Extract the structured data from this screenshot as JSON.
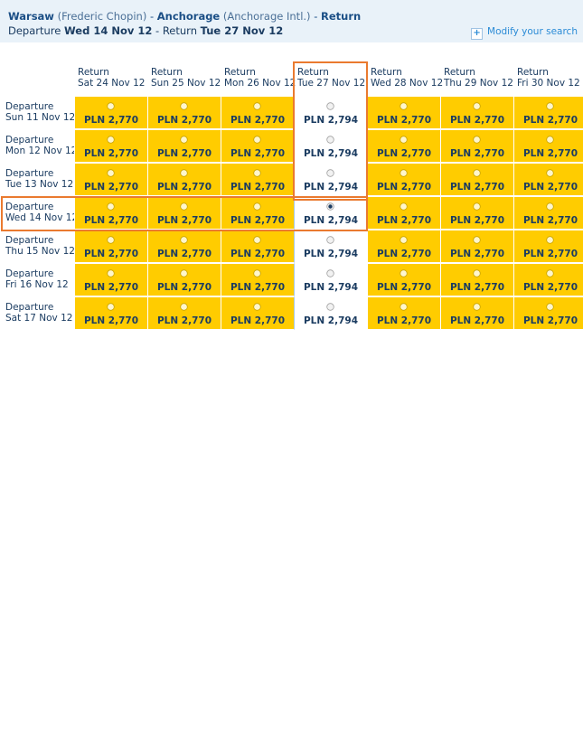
{
  "header": {
    "origin_city": "Warsaw",
    "origin_airport": "(Frederic Chopin)",
    "separator": "-",
    "destination_city": "Anchorage",
    "destination_airport": "(Anchorage Intl.)",
    "trip_type": "Return",
    "departure_label": "Departure",
    "departure_date": "Wed 14 Nov 12",
    "return_label": "- Return",
    "return_date": "Tue 27 Nov 12",
    "modify_link": "Modify your search"
  },
  "columns": [
    {
      "label": "Return",
      "date": "Sat 24 Nov 12"
    },
    {
      "label": "Return",
      "date": "Sun 25 Nov 12"
    },
    {
      "label": "Return",
      "date": "Mon 26 Nov 12"
    },
    {
      "label": "Return",
      "date": "Tue 27 Nov 12"
    },
    {
      "label": "Return",
      "date": "Wed 28 Nov 12"
    },
    {
      "label": "Return",
      "date": "Thu 29 Nov 12"
    },
    {
      "label": "Return",
      "date": "Fri 30 Nov 12"
    }
  ],
  "rows": [
    {
      "label": "Departure",
      "date": "Sun 11 Nov 12",
      "prices": [
        "PLN 2,770",
        "PLN 2,770",
        "PLN 2,770",
        "PLN 2,794",
        "PLN 2,770",
        "PLN 2,770",
        "PLN 2,770"
      ]
    },
    {
      "label": "Departure",
      "date": "Mon 12 Nov 12",
      "prices": [
        "PLN 2,770",
        "PLN 2,770",
        "PLN 2,770",
        "PLN 2,794",
        "PLN 2,770",
        "PLN 2,770",
        "PLN 2,770"
      ]
    },
    {
      "label": "Departure",
      "date": "Tue 13 Nov 12",
      "prices": [
        "PLN 2,770",
        "PLN 2,770",
        "PLN 2,770",
        "PLN 2,794",
        "PLN 2,770",
        "PLN 2,770",
        "PLN 2,770"
      ]
    },
    {
      "label": "Departure",
      "date": "Wed 14 Nov 12",
      "prices": [
        "PLN 2,770",
        "PLN 2,770",
        "PLN 2,770",
        "PLN 2,794",
        "PLN 2,770",
        "PLN 2,770",
        "PLN 2,770"
      ]
    },
    {
      "label": "Departure",
      "date": "Thu 15 Nov 12",
      "prices": [
        "PLN 2,770",
        "PLN 2,770",
        "PLN 2,770",
        "PLN 2,794",
        "PLN 2,770",
        "PLN 2,770",
        "PLN 2,770"
      ]
    },
    {
      "label": "Departure",
      "date": "Fri 16 Nov 12",
      "prices": [
        "PLN 2,770",
        "PLN 2,770",
        "PLN 2,770",
        "PLN 2,794",
        "PLN 2,770",
        "PLN 2,770",
        "PLN 2,770"
      ]
    },
    {
      "label": "Departure",
      "date": "Sat 17 Nov 12",
      "prices": [
        "PLN 2,770",
        "PLN 2,770",
        "PLN 2,770",
        "PLN 2,794",
        "PLN 2,770",
        "PLN 2,770",
        "PLN 2,770"
      ]
    }
  ],
  "selected": {
    "row": 3,
    "column": 3
  },
  "colors": {
    "cheapest": "#ffcc00",
    "other": "#ffffff",
    "highlight": "#ea7a2f",
    "text": "#1b3c61",
    "link": "#2b8bd6"
  },
  "icons": {
    "radio": "radio-button-icon",
    "add": "plus-icon"
  }
}
